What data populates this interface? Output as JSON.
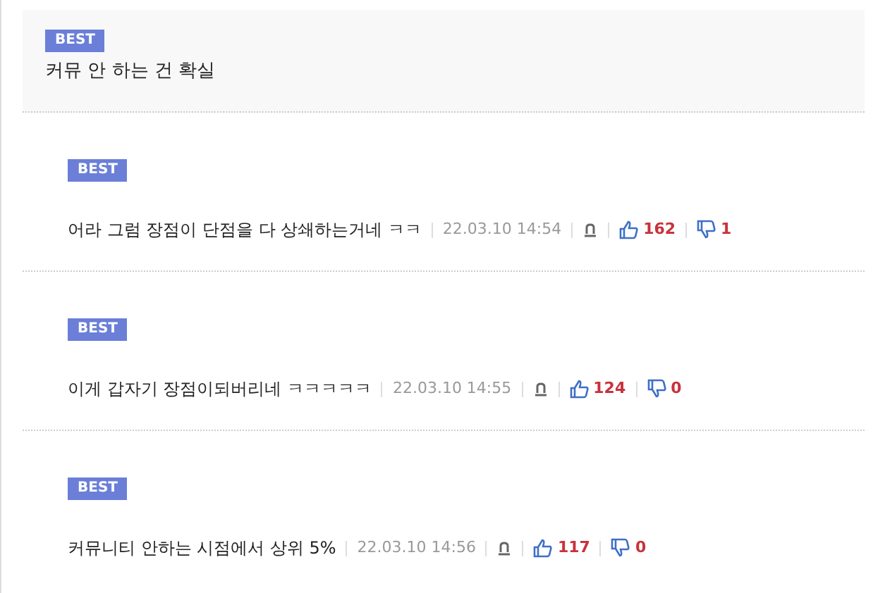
{
  "top_comment": {
    "badge": "BEST",
    "text": "커뮤 안 하는 건 확실"
  },
  "replies": [
    {
      "badge": "BEST",
      "text": "어라 그럼 장점이 단점을 다 상쇄하는거네 ㅋㅋ",
      "time": "22.03.10 14:54",
      "likes": "162",
      "dislikes": "1"
    },
    {
      "badge": "BEST",
      "text": "이게 갑자기 장점이되버리네 ㅋㅋㅋㅋㅋ",
      "time": "22.03.10 14:55",
      "likes": "124",
      "dislikes": "0"
    },
    {
      "badge": "BEST",
      "text": "커뮤니티 안하는 시점에서 상위 5%",
      "time": "22.03.10 14:56",
      "likes": "117",
      "dislikes": "0"
    }
  ]
}
